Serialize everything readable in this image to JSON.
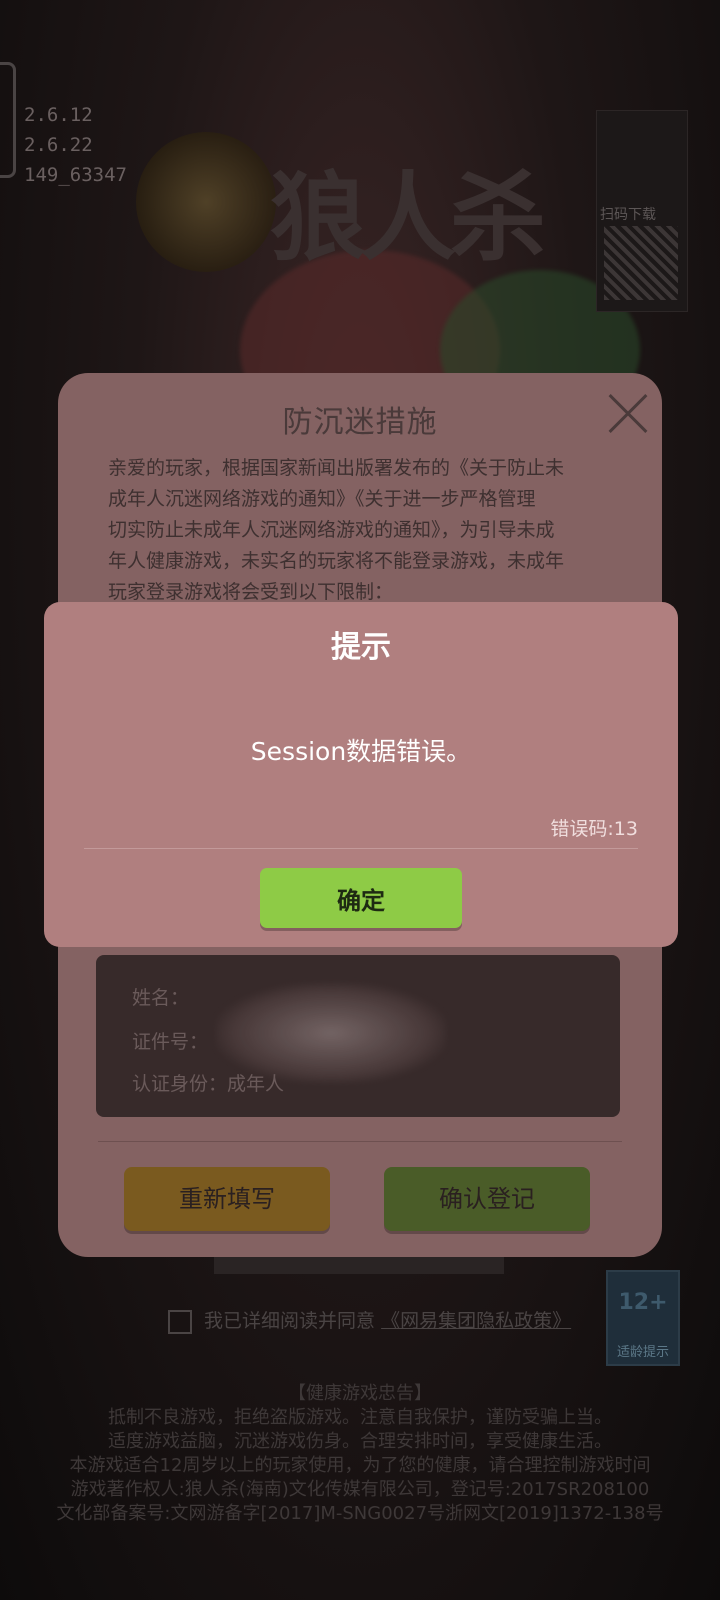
{
  "background": {
    "version_lines": [
      "2.6.12",
      "2.6.22",
      "149_63347"
    ],
    "logo_text": "狼人杀",
    "qr_label": "扫码下载",
    "privacy_text": "我已详细阅读并同意",
    "privacy_link": "《网易集团隐私政策》",
    "age_rating": "12+",
    "age_rating_footer": "适龄提示",
    "health_title": "【健康游戏忠告】",
    "health_lines": [
      "抵制不良游戏，拒绝盗版游戏。注意自我保护，谨防受骗上当。",
      "适度游戏益脑，沉迷游戏伤身。合理安排时间，享受健康生活。",
      "本游戏适合12周岁以上的玩家使用，为了您的健康，请合理控制游戏时间",
      "游戏著作权人:狼人杀(海南)文化传媒有限公司，登记号:2017SR208100",
      "文化部备案号:文网游备字[2017]M-SNG0027号浙网文[2019]1372-138号"
    ]
  },
  "dialog": {
    "title": "防沉迷措施",
    "body_lines": [
      "亲爱的玩家，根据国家新闻出版署发布的《关于防止未",
      "成年人沉迷网络游戏的通知》《关于进一步严格管理",
      "切实防止未成年人沉迷网络游戏的通知》，为引导未成",
      "年人健康游戏，未实名的玩家将不能登录游戏，未成年",
      "玩家登录游戏将会受到以下限制："
    ],
    "info": {
      "name_label": "姓名：",
      "id_label": "证件号：",
      "identity_label": "认证身份：",
      "identity_value": "成年人"
    },
    "refill_label": "重新填写",
    "confirm_label": "确认登记"
  },
  "alert": {
    "title": "提示",
    "message": "Session数据错误。",
    "error_code": "错误码:13",
    "ok_label": "确定"
  },
  "colors": {
    "dialog_bg": "#846262",
    "alert_bg": "#b07f7f",
    "ok_button": "#8ecb46",
    "refill_button": "#7a5a1f",
    "confirm_button": "#4a5c28"
  }
}
